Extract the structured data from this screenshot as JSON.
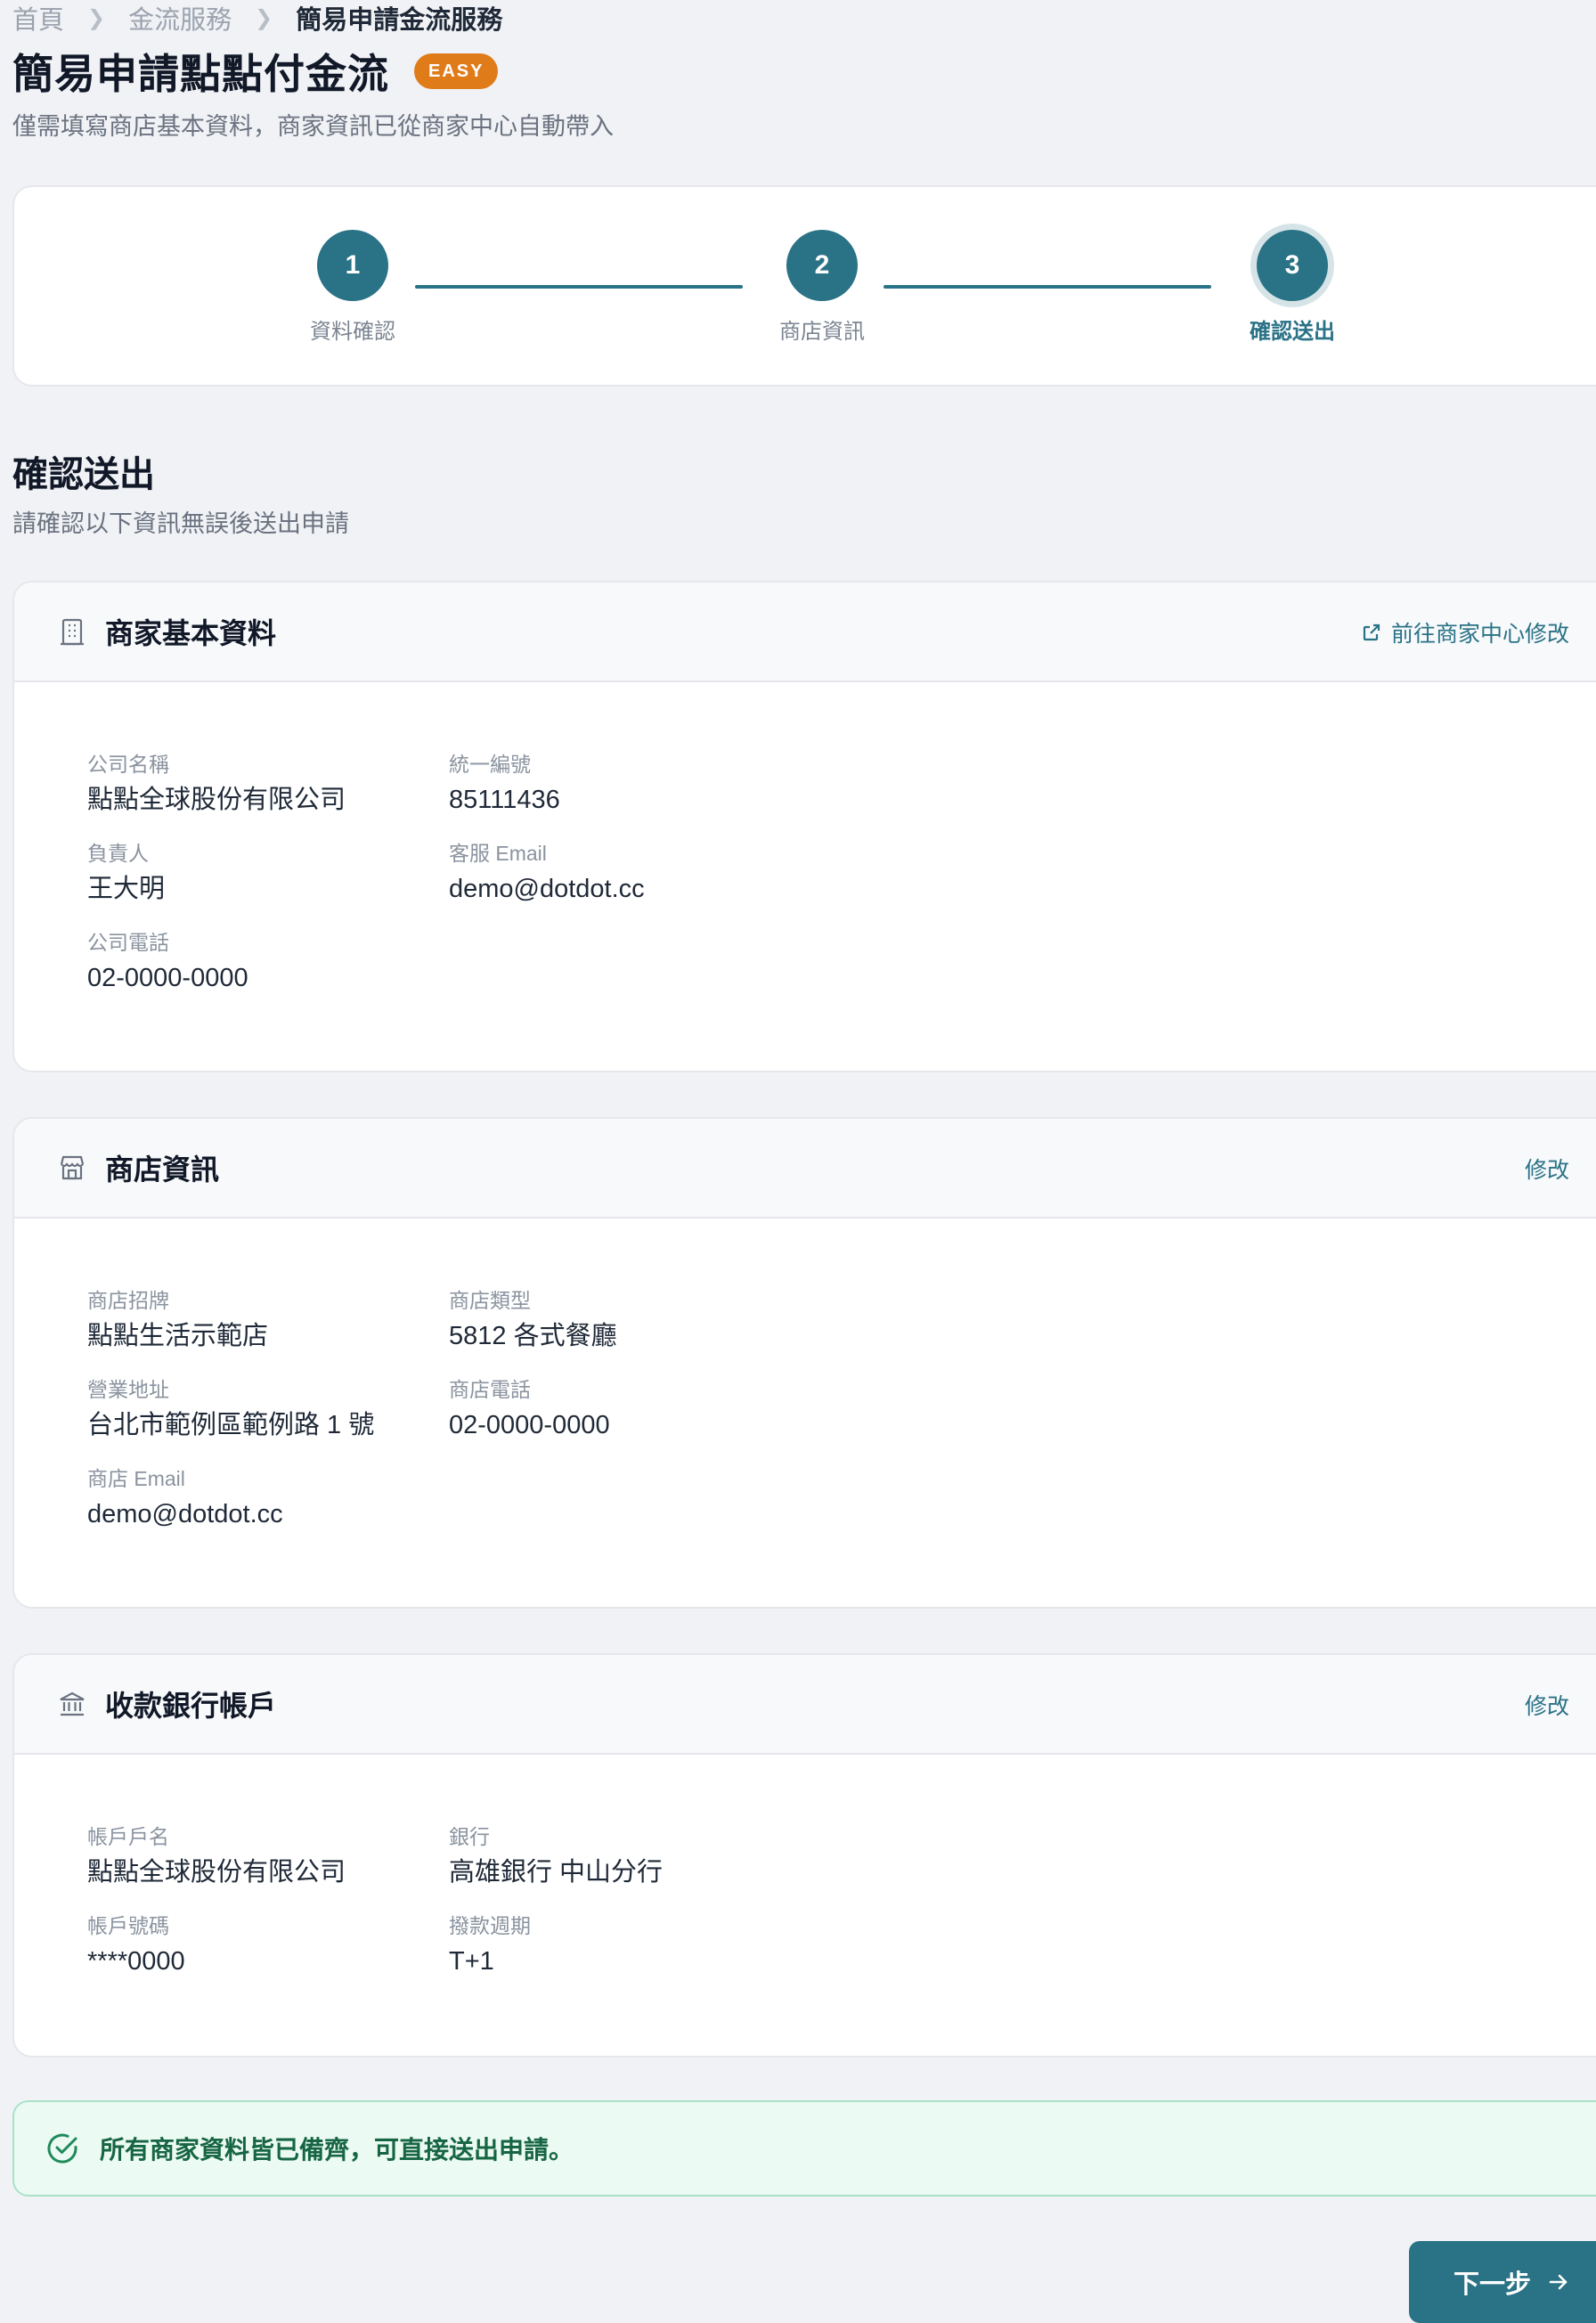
{
  "breadcrumb": {
    "items": [
      "首頁",
      "金流服務"
    ],
    "current": "簡易申請金流服務",
    "separator": ">"
  },
  "header": {
    "title": "簡易申請點點付金流",
    "badge": "EASY",
    "subtitle": "僅需填寫商店基本資料，商家資訊已從商家中心自動帶入"
  },
  "stepper": {
    "steps": [
      {
        "number": "1",
        "label": "資料確認"
      },
      {
        "number": "2",
        "label": "商店資訊"
      },
      {
        "number": "3",
        "label": "確認送出"
      }
    ],
    "active_step": 3
  },
  "section": {
    "title": "確認送出",
    "subtitle": "請確認以下資訊無誤後送出申請"
  },
  "merchant_card": {
    "title": "商家基本資料",
    "icon": "building-icon",
    "action_label": "前往商家中心修改",
    "fields": [
      {
        "label": "公司名稱",
        "value": "點點全球股份有限公司"
      },
      {
        "label": "統一編號",
        "value": "85111436"
      },
      {
        "label": "負責人",
        "value": "王大明"
      },
      {
        "label": "客服 Email",
        "value": "demo@dotdot.cc"
      },
      {
        "label": "公司電話",
        "value": "02-0000-0000"
      }
    ]
  },
  "store_card": {
    "title": "商店資訊",
    "icon": "store-icon",
    "action_label": "修改",
    "fields": [
      {
        "label": "商店招牌",
        "value": "點點生活示範店"
      },
      {
        "label": "商店類型",
        "value": "5812 各式餐廳"
      },
      {
        "label": "營業地址",
        "value": "台北市範例區範例路 1 號"
      },
      {
        "label": "商店電話",
        "value": "02-0000-0000"
      },
      {
        "label": "商店 Email",
        "value": "demo@dotdot.cc"
      }
    ]
  },
  "bank_card": {
    "title": "收款銀行帳戶",
    "icon": "bank-icon",
    "action_label": "修改",
    "fields": [
      {
        "label": "帳戶戶名",
        "value": "點點全球股份有限公司"
      },
      {
        "label": "銀行",
        "value": "高雄銀行 中山分行"
      },
      {
        "label": "帳戶號碼",
        "value": "****0000"
      },
      {
        "label": "撥款週期",
        "value": "T+1"
      }
    ]
  },
  "success_banner": {
    "text": "所有商家資料皆已備齊，可直接送出申請。"
  },
  "actions": {
    "next_label": "下一步"
  },
  "colors": {
    "primary": "#2a7286",
    "badge": "#e07b1a",
    "success_bg": "#ecfaf4",
    "success_text": "#166543",
    "background": "#f0f2f5"
  }
}
